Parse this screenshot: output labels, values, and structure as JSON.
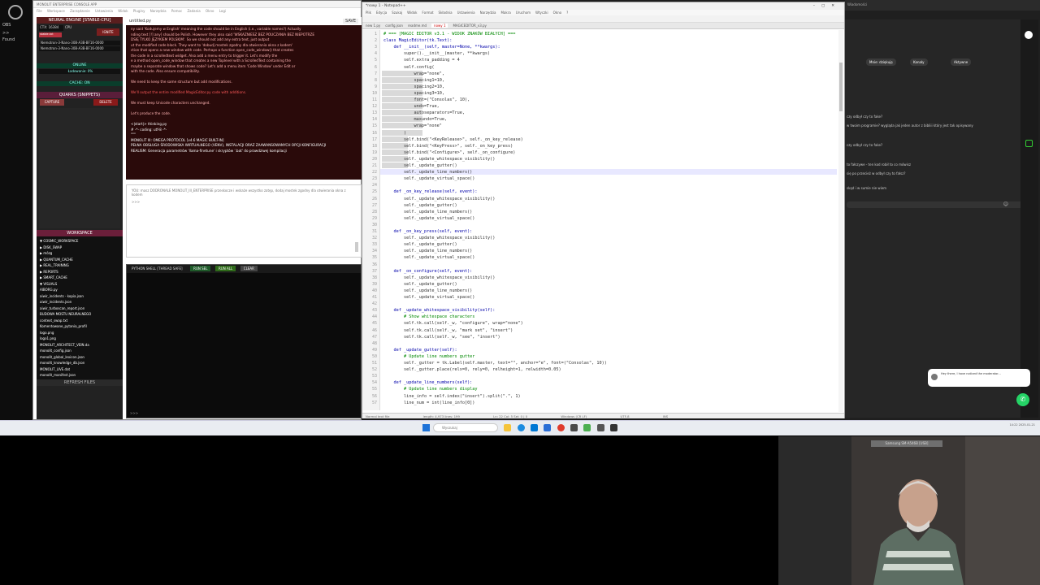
{
  "dock": {
    "labels": [
      "OBS",
      ">>",
      "Found"
    ]
  },
  "app": {
    "title": "MONOLIT ENTERPRISE CONSOLE APP",
    "menu": [
      "File",
      "Workspace",
      "Zarządzanie",
      "Ustawienia",
      "Widok",
      "Pluginy",
      "Narzędzia",
      "Pomoc",
      "Zadania",
      "Okno",
      "Logi"
    ],
    "sidebar": {
      "engine_header": "NEURAL ENGINE [STABLE-CPU]",
      "ctx_field": "CTX: 16384",
      "cpu_label": "CPU",
      "stable_badge": "stable.txt",
      "ignite_button": "IGNITE",
      "models": [
        "Nemotron-3-Nano-30B-A3B-BF16-0000",
        "Nemotron-3-Nano-30B-A3B-BF16-0000"
      ],
      "online_label": "ONLINE",
      "loaded_label": "Ładowanie: 0%",
      "cache_label": "CACHE: ON",
      "quarks_header": "QUARKS (SNIPPETS)",
      "capture_button": "CAPTURE",
      "delete_button": "DELETE",
      "workspace_header": "WORKSPACE",
      "tree": [
        "▼ COSMIC_WORKSPACE",
        "  ▶ DISK_SWAP",
        "  ▶ mózg",
        "  ▶ QUANTUM_CACHE",
        "  ▶ REAL_TRAINING",
        "  ▶ REPORTS",
        "  ▶ SMART_CACHE",
        "  ▼ VISUALS",
        "     AIBORG.py",
        "     aiwir_incidents - kopia.json",
        "     aiwir_incidents.json",
        "     aiwir_turboscan_report.json",
        "     BUDOWA MOSTU NEURALNEGO",
        "     context_swap.txt",
        "     Komentowane_pytania_profil",
        "     logo.png",
        "     logo1.png",
        "     MONOLIT_ARCHITECT_VEIN.da",
        "     monolit_config.json",
        "     monolit_global_lexicon.json",
        "     monolit_knowledge_db.json",
        "     MONOLIT_LIVE.dat",
        "     monolit_manifest.json"
      ],
      "refresh_button": "REFRESH FILES"
    },
    "chat": {
      "tab_title": "untitled.py",
      "save_label": "SAVE",
      "lines": [
        "ny said 'Kodujemy w English' meaning the code should be in English (i.e., variable names?) Actually",
        "nding text [!] any] should be Polish. However they also said 'WSKAZNIESZ BEZ POUCZANIA BEZ NIEPOTRZE",
        "DSIĘ TYLKO JĘZYKIEM POLSKIM'. So we should not add any extra text, just output",
        "ut the modified code block. They want to 'dobudj mostek zgodny dla otwierania okna z kodem'",
        "ction that opens a new window with code. Perhaps a function open_code_window() that creates",
        " the code in a scrolledtext widget. Also add a menu entry to trigger it. Let's modify the",
        "e a method open_code_window that creates a new Toplevel with a ScrolledText containing the",
        " maybe a separate window that shows code? Let's add a menu item 'Code Window' under Edit or",
        " with the code. Also ensure compatibility.",
        "",
        "We need to keep the same structure but add modifications.",
        "",
        "We'll output the entire modified MagicEditor.py code with additions.",
        "",
        "We must keep Unicode characters unchanged.",
        "",
        "Let's produce the code.",
        "",
        "<|start|> thinking.py",
        "# -*- coding: utf-8 -*-",
        "\"\"\"",
        "MONOLIT III: OMEGA PROTOCOL [v4.6 MAGIC BUILT-IN]",
        "PEŁNA OBSŁUGA ŚRODOWISKA WIRTUALNEGO (VENV), INSTALACJI ORAZ ZAAWANSOWANYCH OPCJI KONFIGURACJI",
        "REALISM: Generacja parametrów 'llama-finetune' i skryptów '.bat' do prawdziwej kompilacji"
      ]
    },
    "input": {
      "text": "YOU: masz DODRONALE MONOLIT_III_ENTERPRISE przeskocze i wskaże wszystko zatęp, dodaj mostek zgodny dla otwierania okna z kodem",
      "text2": ">>>"
    },
    "shell": {
      "title": "PYTHON SHELL [THREAD SAFE]",
      "run_sel": "RUN SEL",
      "run_all": "RUN ALL",
      "clear": "CLEAR",
      "prompt": ">>>"
    }
  },
  "notepad": {
    "title": "*nowy 1 - Notepad++",
    "menu": [
      "Plik",
      "Edycja",
      "Szukaj",
      "Widok",
      "Format",
      "Składnia",
      "Ustawienia",
      "Narzędzia",
      "Makra",
      "Uruchom",
      "Wtyczki",
      "Okno",
      "?"
    ],
    "tabs": [
      "new 1.py",
      "config.json",
      "readme.md",
      "nowy 1",
      "MAGICEDITOR_v3.py"
    ],
    "active_tab": "nowy 1",
    "lines": [
      {
        "n": "1",
        "t": "# === [MAGIC EDITOR v3.1 - WIDOK ZNAKÓW BIAŁYCH] ===",
        "c": "cm"
      },
      {
        "n": "2",
        "t": "class MagicEditor(tk.Text):",
        "c": "kw"
      },
      {
        "n": "3",
        "t": "    def __init__(self, master=None, **kwargs):",
        "c": "kw"
      },
      {
        "n": "4",
        "t": "        super().__init__(master, **kwargs)",
        "c": ""
      },
      {
        "n": "5",
        "t": "        self.extra_padding = 4",
        "c": ""
      },
      {
        "n": "6",
        "t": "        self.config(",
        "c": ""
      },
      {
        "n": "7",
        "t": "            wrap=\"none\",",
        "c": ""
      },
      {
        "n": "8",
        "t": "            spacing1=10,",
        "c": ""
      },
      {
        "n": "9",
        "t": "            spacing2=10,",
        "c": ""
      },
      {
        "n": "10",
        "t": "            spacing3=10,",
        "c": ""
      },
      {
        "n": "11",
        "t": "            font=(\"Consolas\", 10),",
        "c": ""
      },
      {
        "n": "12",
        "t": "            undo=True,",
        "c": ""
      },
      {
        "n": "13",
        "t": "            autoseparators=True,",
        "c": ""
      },
      {
        "n": "14",
        "t": "            maxundo=True,",
        "c": ""
      },
      {
        "n": "15",
        "t": "            wrap=\"none\"",
        "c": ""
      },
      {
        "n": "16",
        "t": "        )",
        "c": ""
      },
      {
        "n": "17",
        "t": "        self.bind(\"<KeyRelease>\", self._on_key_release)",
        "c": ""
      },
      {
        "n": "18",
        "t": "        self.bind(\"<KeyPress>\", self._on_key_press)",
        "c": ""
      },
      {
        "n": "19",
        "t": "        self.bind(\"<Configure>\", self._on_configure)",
        "c": ""
      },
      {
        "n": "20",
        "t": "        self._update_whitespace_visibility()",
        "c": ""
      },
      {
        "n": "21",
        "t": "        self._update_gutter()",
        "c": ""
      },
      {
        "n": "22",
        "t": "        self._update_line_numbers()",
        "c": ""
      },
      {
        "n": "23",
        "t": "        self._update_virtual_space()",
        "c": ""
      },
      {
        "n": "24",
        "t": "",
        "c": ""
      },
      {
        "n": "25",
        "t": "    def _on_key_release(self, event):",
        "c": "kw"
      },
      {
        "n": "26",
        "t": "        self._update_whitespace_visibility()",
        "c": ""
      },
      {
        "n": "27",
        "t": "        self._update_gutter()",
        "c": ""
      },
      {
        "n": "28",
        "t": "        self._update_line_numbers()",
        "c": ""
      },
      {
        "n": "29",
        "t": "        self._update_virtual_space()",
        "c": ""
      },
      {
        "n": "30",
        "t": "",
        "c": ""
      },
      {
        "n": "31",
        "t": "    def _on_key_press(self, event):",
        "c": "kw"
      },
      {
        "n": "32",
        "t": "        self._update_whitespace_visibility()",
        "c": ""
      },
      {
        "n": "33",
        "t": "        self._update_gutter()",
        "c": ""
      },
      {
        "n": "34",
        "t": "        self._update_line_numbers()",
        "c": ""
      },
      {
        "n": "35",
        "t": "        self._update_virtual_space()",
        "c": ""
      },
      {
        "n": "36",
        "t": "",
        "c": ""
      },
      {
        "n": "37",
        "t": "    def _on_configure(self, event):",
        "c": "kw"
      },
      {
        "n": "38",
        "t": "        self._update_whitespace_visibility()",
        "c": ""
      },
      {
        "n": "39",
        "t": "        self._update_gutter()",
        "c": ""
      },
      {
        "n": "40",
        "t": "        self._update_line_numbers()",
        "c": ""
      },
      {
        "n": "41",
        "t": "        self._update_virtual_space()",
        "c": ""
      },
      {
        "n": "42",
        "t": "",
        "c": ""
      },
      {
        "n": "43",
        "t": "    def _update_whitespace_visibility(self):",
        "c": "kw"
      },
      {
        "n": "44",
        "t": "        # Show whitespace characters",
        "c": "cm"
      },
      {
        "n": "45",
        "t": "        self.tk.call(self._w, \"configure\", wrap=\"none\")",
        "c": ""
      },
      {
        "n": "46",
        "t": "        self.tk.call(self._w, \"mark set\", \"insert\")",
        "c": ""
      },
      {
        "n": "47",
        "t": "        self.tk.call(self._w, \"see\", \"insert\")",
        "c": ""
      },
      {
        "n": "48",
        "t": "",
        "c": ""
      },
      {
        "n": "49",
        "t": "    def _update_gutter(self):",
        "c": "kw"
      },
      {
        "n": "50",
        "t": "        # Update line numbers gutter",
        "c": "cm"
      },
      {
        "n": "51",
        "t": "        self._gutter = tk.Label(self.master, text=\"\", anchor=\"e\", font=(\"Consolas\", 10))",
        "c": ""
      },
      {
        "n": "52",
        "t": "        self._gutter.place(relx=0, rely=0, relheight=1, relwidth=0.05)",
        "c": ""
      },
      {
        "n": "53",
        "t": "",
        "c": ""
      },
      {
        "n": "54",
        "t": "    def _update_line_numbers(self):",
        "c": "kw"
      },
      {
        "n": "55",
        "t": "        # Update line numbers display",
        "c": "cm"
      },
      {
        "n": "56",
        "t": "        line_info = self.index(\"insert\").split(\".\", 1)",
        "c": ""
      },
      {
        "n": "57",
        "t": "        line_num = int(line_info[0])",
        "c": ""
      }
    ],
    "status": [
      "Normal text file",
      "length: 4,973  lines: 199",
      "Ln: 22   Col: 5   Sel: 0 | 0",
      "Windows (CR LF)",
      "UTF-8",
      "INS"
    ]
  },
  "browser": {
    "tabs": "Wiadomości",
    "chips": [
      "Mnie: dziękuję",
      "Kanały",
      "Aktywne"
    ],
    "messages": [
      "czy odbył czy to fake?",
      "w twoim programie? wygląda jak jeden autor z bibliii który jest tak opisywany",
      "czy odbył czy to fake?",
      "to fałszywe - ten kod robił to co mówisz",
      "się po przecież w odbył czy to fałsz?",
      "skąd i w sumie nie wiem"
    ],
    "notification": "Hey there, I have noticed the moderator..."
  },
  "taskbar": {
    "search": "Wyszukaj",
    "tray": "14:22  2025-01-21"
  },
  "webcam": {
    "label": "Samsung SM-A546B [USB]"
  }
}
